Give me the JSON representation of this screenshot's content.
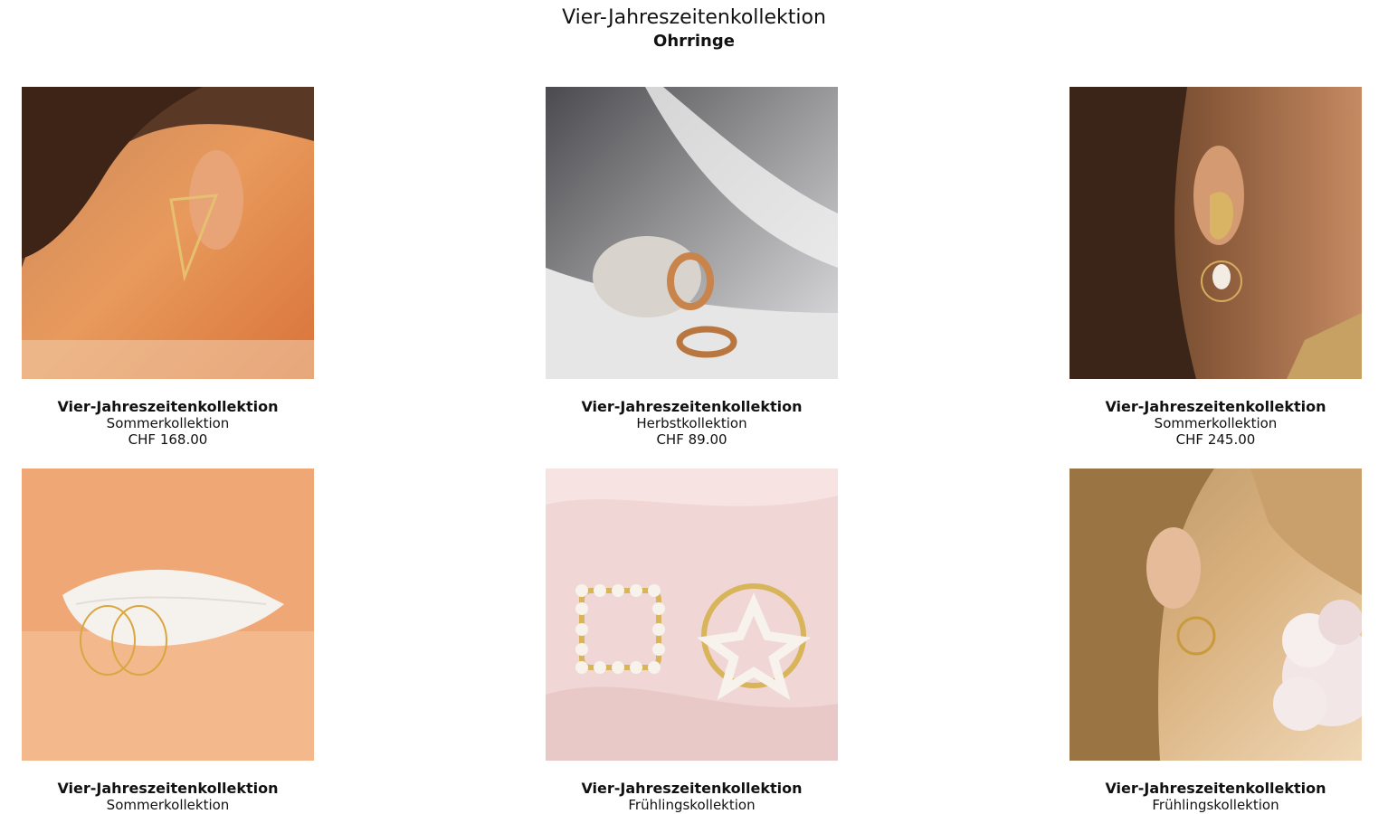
{
  "header": {
    "title": "Vier-Jahreszeitenkollektion",
    "subtitle": "Ohrringe"
  },
  "products": [
    {
      "name": "Vier-Jahreszeitenkollektion",
      "collection": "Sommerkollektion",
      "price": "CHF 168.00",
      "image": "woman-wearing-triangle-gold-earring"
    },
    {
      "name": "Vier-Jahreszeitenkollektion",
      "collection": "Herbstkollektion",
      "price": "CHF 89.00",
      "image": "twisted-gold-hoops-on-stone"
    },
    {
      "name": "Vier-Jahreszeitenkollektion",
      "collection": "Sommerkollektion",
      "price": "CHF 245.00",
      "image": "woman-wearing-pearl-drop-earring"
    },
    {
      "name": "Vier-Jahreszeitenkollektion",
      "collection": "Sommerkollektion",
      "image": "gold-hoops-on-seashell"
    },
    {
      "name": "Vier-Jahreszeitenkollektion",
      "collection": "Frühlingskollektion",
      "image": "pearl-square-and-star-hoops"
    },
    {
      "name": "Vier-Jahreszeitenkollektion",
      "collection": "Frühlingskollektion",
      "image": "woman-with-flowers-wearing-gold-hoop"
    }
  ]
}
